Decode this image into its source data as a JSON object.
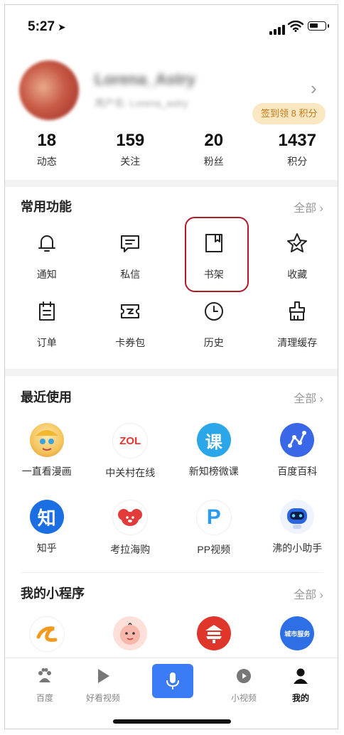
{
  "status_bar": {
    "time": "5:27"
  },
  "profile": {
    "username": "Lorena_Astry",
    "subtitle": "用户名: Lorena_astry",
    "signin_badge": "签到领 8 积分"
  },
  "stats": [
    {
      "value": "18",
      "label": "动态"
    },
    {
      "value": "159",
      "label": "关注"
    },
    {
      "value": "20",
      "label": "粉丝"
    },
    {
      "value": "1437",
      "label": "积分"
    }
  ],
  "common_functions": {
    "title": "常用功能",
    "all_label": "全部 ›",
    "items": [
      {
        "label": "通知",
        "icon": "bell-icon"
      },
      {
        "label": "私信",
        "icon": "message-icon"
      },
      {
        "label": "书架",
        "icon": "bookshelf-icon"
      },
      {
        "label": "收藏",
        "icon": "star-icon"
      },
      {
        "label": "订单",
        "icon": "order-icon"
      },
      {
        "label": "卡券包",
        "icon": "coupon-icon"
      },
      {
        "label": "历史",
        "icon": "clock-icon"
      },
      {
        "label": "清理缓存",
        "icon": "broom-icon"
      }
    ]
  },
  "recent": {
    "title": "最近使用",
    "all_label": "全部 ›",
    "items": [
      {
        "label": "一直看漫画",
        "icon": "comic-app-icon",
        "glyph": "",
        "color": "#f5c35a"
      },
      {
        "label": "中关村在线",
        "icon": "zol-app-icon",
        "glyph": "ZOL",
        "color": "#e8322f"
      },
      {
        "label": "新知榜微课",
        "icon": "course-app-icon",
        "glyph": "课",
        "color": "#2aa6e9"
      },
      {
        "label": "百度百科",
        "icon": "baike-app-icon",
        "glyph": "",
        "color": "#3a67e8"
      },
      {
        "label": "知乎",
        "icon": "zhihu-app-icon",
        "glyph": "知",
        "color": "#1b6fe3"
      },
      {
        "label": "考拉海购",
        "icon": "kaola-app-icon",
        "glyph": "",
        "color": "#e33a3a"
      },
      {
        "label": "PP视频",
        "icon": "pp-video-app-icon",
        "glyph": "P",
        "color": "#2a9bf0"
      },
      {
        "label": "沸的小助手",
        "icon": "robot-app-icon",
        "glyph": "",
        "color": "#2b66e0"
      }
    ]
  },
  "mini_programs": {
    "title": "我的小程序",
    "all_label": "全部 ›",
    "items": [
      {
        "icon": "orange-swirl-app-icon",
        "glyph": "",
        "color": "#f29a1f"
      },
      {
        "icon": "baby-app-icon",
        "glyph": "",
        "color": "#f5a9a0"
      },
      {
        "icon": "temple-app-icon",
        "glyph": "",
        "color": "#e0352b"
      },
      {
        "icon": "city-service-app-icon",
        "glyph": "城市服务",
        "color": "#2f6fe6"
      }
    ]
  },
  "bottom_nav": {
    "items": [
      {
        "label": "百度",
        "icon": "paw-icon"
      },
      {
        "label": "好看视频",
        "icon": "play-icon"
      },
      {
        "label": "小视频",
        "icon": "short-video-icon"
      },
      {
        "label": "我的",
        "icon": "person-icon"
      }
    ],
    "mic_icon": "microphone-icon"
  }
}
